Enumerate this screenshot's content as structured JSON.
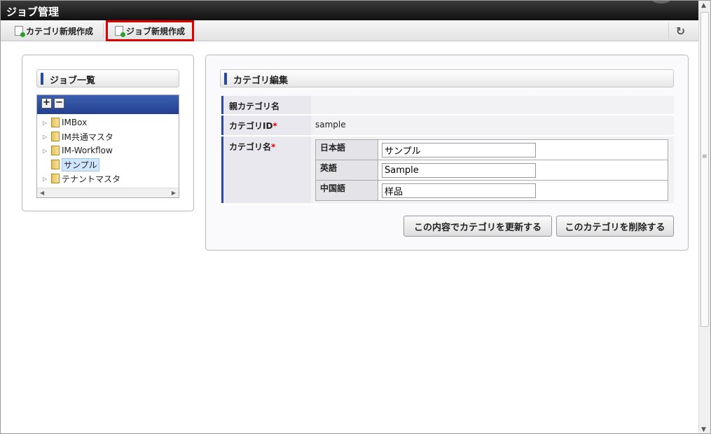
{
  "window": {
    "title": "ジョブ管理"
  },
  "toolbar": {
    "create_category_label": "カテゴリ新規作成",
    "create_job_label": "ジョブ新規作成",
    "refresh_icon": "refresh-icon"
  },
  "left_panel": {
    "heading": "ジョブ一覧",
    "tree": {
      "expand_all": "+",
      "collapse_all": "−",
      "items": [
        {
          "label": "IMBox",
          "selected": false
        },
        {
          "label": "IM共通マスタ",
          "selected": false
        },
        {
          "label": "IM-Workflow",
          "selected": false
        },
        {
          "label": "サンプル",
          "selected": true
        },
        {
          "label": "テナントマスタ",
          "selected": false
        }
      ]
    }
  },
  "right_panel": {
    "heading": "カテゴリ編集",
    "fields": {
      "parent_label": "親カテゴリ名",
      "parent_value": "",
      "id_label": "カテゴリID",
      "id_value": "sample",
      "name_label": "カテゴリ名",
      "required_mark": "*"
    },
    "languages": [
      {
        "label": "日本語",
        "value": "サンプル"
      },
      {
        "label": "英語",
        "value": "Sample"
      },
      {
        "label": "中国語",
        "value": "样品"
      }
    ],
    "buttons": {
      "update": "この内容でカテゴリを更新する",
      "delete": "このカテゴリを削除する"
    }
  }
}
